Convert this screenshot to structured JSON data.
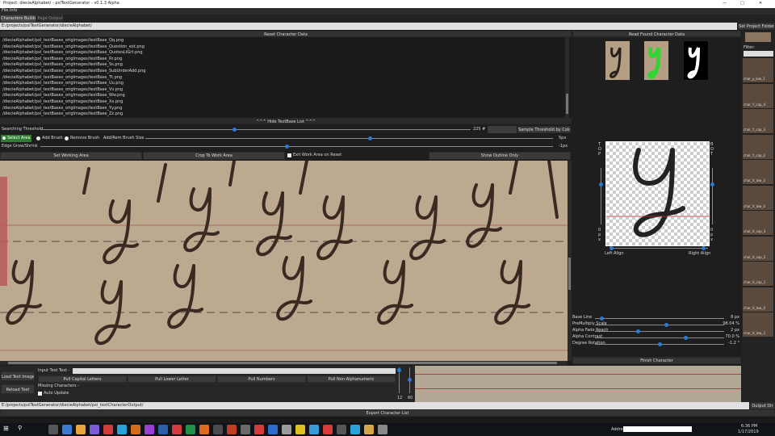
{
  "window": {
    "title": "Project: diecieAlphabet/ - pxlTextGenerator - v0.1.3 Alpha"
  },
  "menubar": {
    "file_info": "File Info"
  },
  "tabs": [
    {
      "label": "Characters Builder",
      "active": true
    },
    {
      "label": "Page Output",
      "active": false
    }
  ],
  "path_bar": {
    "value": "E:/projects/pxlTextGenerator/diecieAlphabet/",
    "set_project_button": "Set Project Folder"
  },
  "left_panel": {
    "reset_button": "Reset Character Data",
    "files": [
      "/diecieAlphabet/pxl_textBases_origImages/textBase_Qq.png",
      "/diecieAlphabet/pxl_textBases_origImages/textBase_Question_ext.png",
      "/diecieAlphabet/pxl_textBases_origImages/textBase_QuotesLtGrt.png",
      "/diecieAlphabet/pxl_textBases_origImages/textBase_Rr.png",
      "/diecieAlphabet/pxl_textBases_origImages/textBase_Ss.png",
      "/diecieAlphabet/pxl_textBases_origImages/textBase_SubUnderAdd.png",
      "/diecieAlphabet/pxl_textBases_origImages/textBase_Tt.png",
      "/diecieAlphabet/pxl_textBases_origImages/textBase_Uu.png",
      "/diecieAlphabet/pxl_textBases_origImages/textBase_Vv.png",
      "/diecieAlphabet/pxl_textBases_origImages/textBase_Ww.png",
      "/diecieAlphabet/pxl_textBases_origImages/textBase_Xx.png",
      "/diecieAlphabet/pxl_textBases_origImages/textBase_Yy.png",
      "/diecieAlphabet/pxl_textBases_origImages/textBase_Zz.png"
    ],
    "hide_list": "^^^ Hide TextBase List ^^^",
    "searching_threshold_label": "Searching Threshold",
    "searching_threshold_value": "225 #",
    "searching_threshold_level": 0.45,
    "sample_threshold_button": "Sample Threshold by Color",
    "modes": [
      "Select Area",
      "Add Brush",
      "Remove Brush"
    ],
    "brush_size_label": "Add/Rem Brush Size",
    "brush_size_value": "5px",
    "brush_size_level": 0.55,
    "edge_label": "Edge Grow/Shrink",
    "edge_value": "-1px",
    "edge_level": 0.48,
    "set_working_area": "Set Working Area",
    "crop_to_work": "Crop To Work Area",
    "exit_work_area": "Exit Work Area on Reset",
    "show_outline": "Show Outline Only"
  },
  "right_panel": {
    "read_found": "Read Found Character Data",
    "top_label": "T O P",
    "bottom_label": "B O T",
    "px_left": "0 p x",
    "px_right": "0 p x",
    "left_align": "Left Align",
    "right_align": "Right Align",
    "sliders": [
      {
        "label": "Base Line",
        "value": "8 px",
        "level": 0.05
      },
      {
        "label": "PreMultiply Scale",
        "value": "98.04 %",
        "level": 0.55
      },
      {
        "label": "Alpha Fade Reach",
        "value": "2 px",
        "level": 0.33
      },
      {
        "label": "Alpha Contrast",
        "value": "70.0 %",
        "level": 0.7
      },
      {
        "label": "Degree Rotation",
        "value": "-1.2 °",
        "level": 0.5
      }
    ],
    "finish_button": "Finish Character"
  },
  "sidebar": {
    "filter_label": "Filter:",
    "items": [
      "char_y_low_1",
      "char_Y_cap_4",
      "char_Y_cap_3",
      "char_Y_cap_2",
      "char_X_low_3",
      "char_X_low_4",
      "char_X_cap_3",
      "char_X_cap_2",
      "char_X_cap_1",
      "char_X_low_4",
      "char_X_low_3"
    ]
  },
  "bottom": {
    "load_text_image": "Load Text Image",
    "reload_text": "Reload Text",
    "input_label": "Input Test Text -",
    "pull_buttons": [
      "Pull Capital Letters",
      "Pull Lower Letter",
      "Pull Numbers",
      "Pull Non-Alphanumeric"
    ],
    "missing_label": "Missing Characters -",
    "auto_update": "Auto Update",
    "size_a": "12",
    "size_b": "60",
    "output_path": "E:/projects/pxlTextGenerator/diecieAlphabet/pxl_textCharacterOutput/",
    "output_dir_button": "Output Dir",
    "export_button": "Export Character List"
  },
  "taskbar": {
    "address_label": "Address",
    "time": "6:36 PM",
    "date": "1/17/2019"
  },
  "colors": {
    "accent": "#2a7ad6",
    "green": "#35d435",
    "paper": "#bda98f"
  }
}
